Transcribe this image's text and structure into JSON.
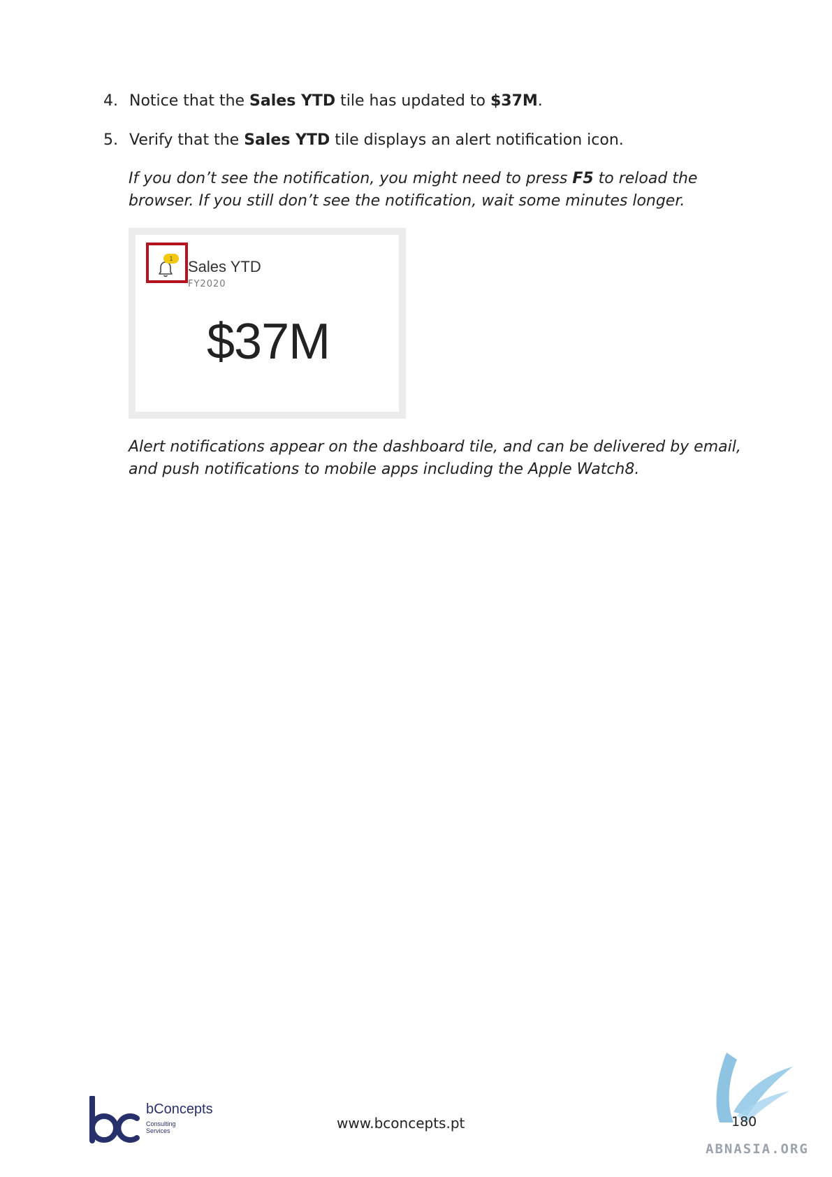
{
  "steps": [
    {
      "number": "4.",
      "parts": [
        "Notice that the ",
        "Sales YTD",
        " tile has updated to ",
        "$37M",
        "."
      ]
    },
    {
      "number": "5.",
      "parts": [
        "Verify that the ",
        "Sales YTD",
        " tile displays an alert notification icon."
      ]
    }
  ],
  "notes": [
    {
      "parts": [
        "If you don’t see the notification, you might need to press ",
        "F5",
        " to reload the browser. If you still don’t see the notification, wait some minutes longer."
      ]
    },
    {
      "text": "Alert notifications appear on the dashboard tile, and can be delivered by email, and push notifications to mobile apps including the Apple Watch8."
    }
  ],
  "tile": {
    "title": "Sales YTD",
    "subtitle": "FY2020",
    "value": "$37M",
    "alert_count": "1",
    "highlight_color": "#b5121b",
    "badge_color": "#f2c811",
    "icon": "bell-icon"
  },
  "footer": {
    "logo_name": "bConcepts",
    "logo_tagline_1": "Consulting",
    "logo_tagline_2": "Services",
    "website": "www.bconcepts.pt",
    "page_number": "180",
    "watermark": "ABNASIA.ORG",
    "brand_color": "#27306b"
  }
}
